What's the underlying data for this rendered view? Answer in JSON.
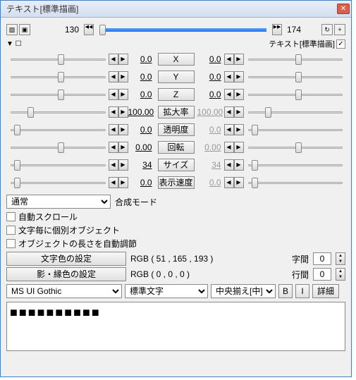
{
  "title": "テキスト[標準描画]",
  "timeline": {
    "start": "130",
    "end": "174"
  },
  "tag": "テキスト[標準描画]",
  "params": [
    {
      "name": "X",
      "l": "0.0",
      "r": "0.0",
      "lp": 50,
      "rp": 50
    },
    {
      "name": "Y",
      "l": "0.0",
      "r": "0.0",
      "lp": 50,
      "rp": 50
    },
    {
      "name": "Z",
      "l": "0.0",
      "r": "0.0",
      "lp": 50,
      "rp": 50
    },
    {
      "name": "拡大率",
      "l": "100.00",
      "r": "100.00",
      "lp": 18,
      "rp": 18
    },
    {
      "name": "透明度",
      "l": "0.0",
      "r": "0.0",
      "lp": 4,
      "rp": 4
    },
    {
      "name": "回転",
      "l": "0.00",
      "r": "0.00",
      "lp": 50,
      "rp": 50
    },
    {
      "name": "サイズ",
      "l": "34",
      "r": "34",
      "lp": 4,
      "rp": 4
    },
    {
      "name": "表示速度",
      "l": "0.0",
      "r": "0.0",
      "lp": 4,
      "rp": 4
    }
  ],
  "blend_label": "合成モード",
  "blend": "通常",
  "chk1": "自動スクロール",
  "chk2": "文字毎に個別オブジェクト",
  "chk3": "オブジェクトの長さを自動調節",
  "color1_btn": "文字色の設定",
  "color1_val": "RGB ( 51 , 165 , 193 )",
  "color2_btn": "影・縁色の設定",
  "color2_val": "RGB ( 0 , 0 , 0 )",
  "spacing_label": "字間",
  "spacing": "0",
  "leading_label": "行間",
  "leading": "0",
  "font": "MS UI Gothic",
  "style": "標準文字",
  "align": "中央揃え[中]",
  "bold": "B",
  "italic": "I",
  "detail": "詳細",
  "text": "■■■■■■■■■■"
}
